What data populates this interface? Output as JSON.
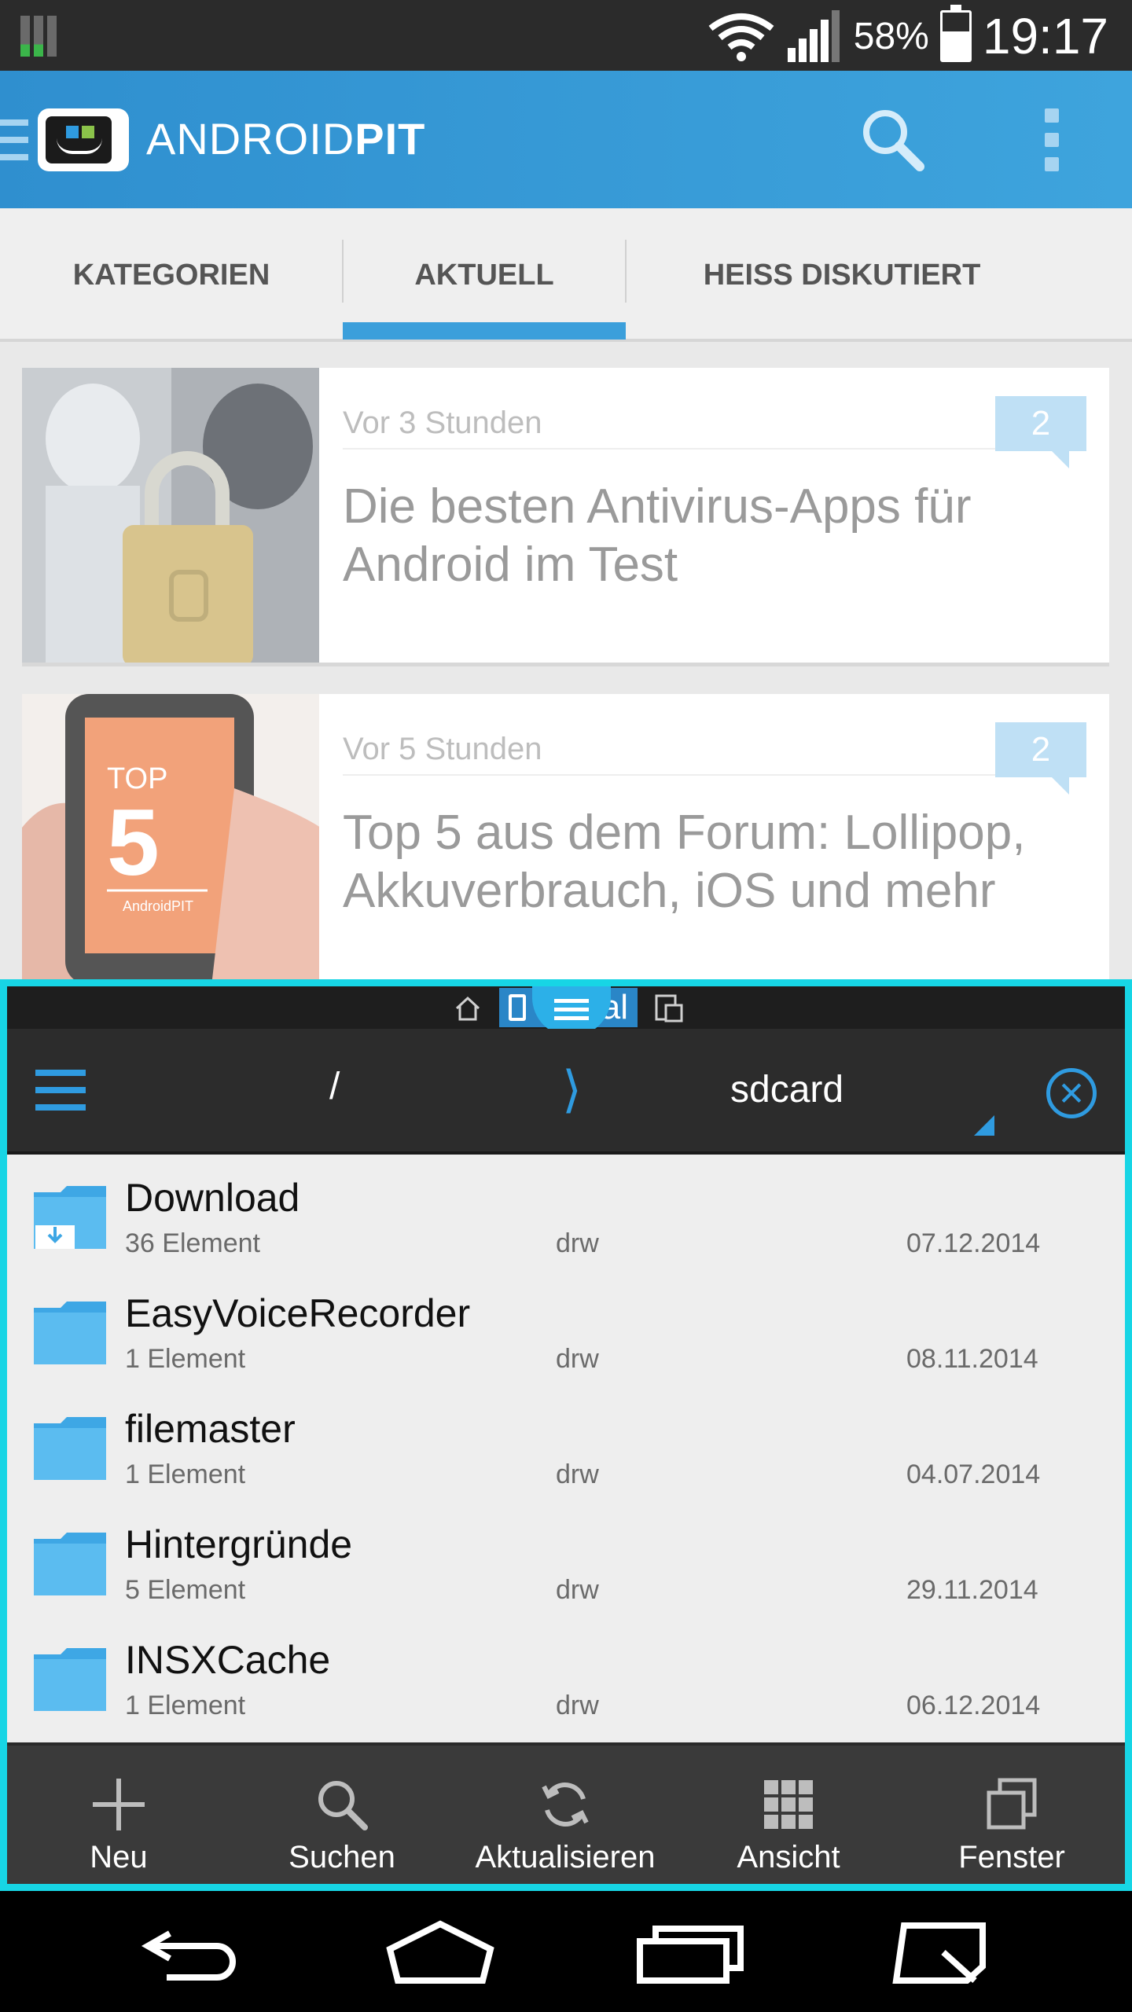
{
  "status_bar": {
    "battery": "58%",
    "time": "19:17"
  },
  "app_bar": {
    "brand_light": "ANDROID",
    "brand_bold": "PIT"
  },
  "tabs": [
    {
      "label": "KATEGORIEN"
    },
    {
      "label": "AKTUELL",
      "selected": true
    },
    {
      "label": "HEISS DISKUTIERT"
    }
  ],
  "articles": [
    {
      "time": "Vor 3 Stunden",
      "title": "Die besten Antivirus-Apps für Android im Test",
      "comments": "2"
    },
    {
      "time": "Vor 5 Stunden",
      "title": "Top 5 aus dem Forum: Lollipop, Akkuverbrauch, iOS und mehr",
      "comments": "2"
    }
  ],
  "thumb2": {
    "top": "TOP",
    "five": "5",
    "brand": "AndroidPIT"
  },
  "file_manager": {
    "storage_tab": "al",
    "path_root": "/",
    "path_current": "sdcard",
    "files": [
      {
        "name": "Download",
        "count": "36 Element",
        "perm": "drw",
        "date": "07.12.2014",
        "icon": "download-folder-icon"
      },
      {
        "name": "EasyVoiceRecorder",
        "count": "1 Element",
        "perm": "drw",
        "date": "08.11.2014",
        "icon": "folder-icon"
      },
      {
        "name": "filemaster",
        "count": "1 Element",
        "perm": "drw",
        "date": "04.07.2014",
        "icon": "folder-icon"
      },
      {
        "name": "Hintergründe",
        "count": "5 Element",
        "perm": "drw",
        "date": "29.11.2014",
        "icon": "folder-icon"
      },
      {
        "name": "INSXCache",
        "count": "1 Element",
        "perm": "drw",
        "date": "06.12.2014",
        "icon": "folder-icon"
      }
    ],
    "actions": [
      {
        "label": "Neu",
        "icon": "plus-icon"
      },
      {
        "label": "Suchen",
        "icon": "search-icon"
      },
      {
        "label": "Aktualisieren",
        "icon": "refresh-icon"
      },
      {
        "label": "Ansicht",
        "icon": "grid-icon"
      },
      {
        "label": "Fenster",
        "icon": "windows-icon"
      }
    ]
  },
  "colors": {
    "accent": "#3b9fdb",
    "overlay_border": "#17d5e5",
    "folder": "#4fb3ea"
  }
}
